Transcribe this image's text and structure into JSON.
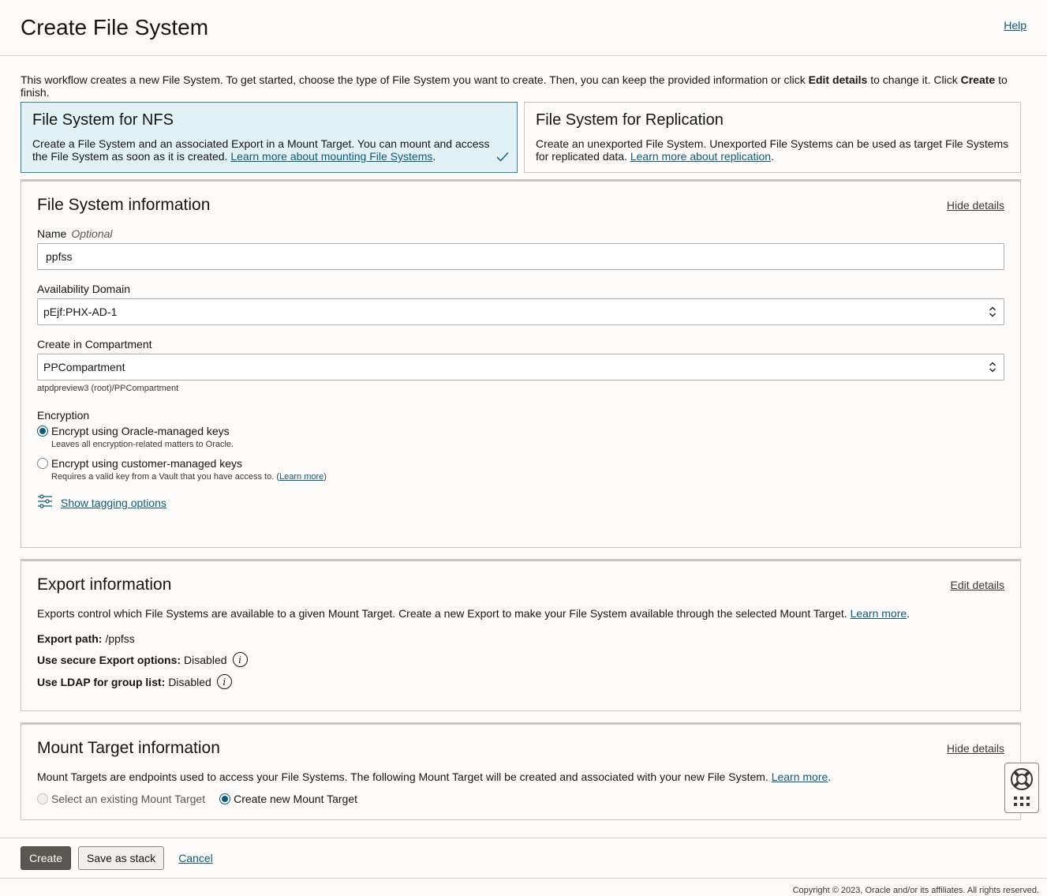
{
  "header": {
    "title": "Create File System",
    "help_label": "Help"
  },
  "intro": {
    "part1": "This workflow creates a new File System. To get started, choose the type of File System you want to create. Then, you can keep the provided information or click ",
    "bold1": "Edit details",
    "part2": " to change it. Click ",
    "bold2": "Create",
    "part3": " to finish."
  },
  "cards": [
    {
      "title": "File System for NFS",
      "desc": "Create a File System and an associated Export in a Mount Target. You can mount and access the File System as soon as it is created. ",
      "link": "Learn more about mounting File Systems",
      "suffix": ".",
      "selected": true
    },
    {
      "title": "File System for Replication",
      "desc": "Create an unexported File System. Unexported File Systems can be used as target File Systems for replicated data. ",
      "link": "Learn more about replication",
      "suffix": ".",
      "selected": false
    }
  ],
  "fs_info": {
    "title": "File System information",
    "toggle_label": "Hide details",
    "name_label": "Name",
    "name_optional": "Optional",
    "name_value": "ppfss",
    "ad_label": "Availability Domain",
    "ad_value": "pEjf:PHX-AD-1",
    "compartment_label": "Create in Compartment",
    "compartment_value": "PPCompartment",
    "compartment_path": "atpdpreview3 (root)/PPCompartment",
    "encryption_label": "Encryption",
    "enc_oracle_label": "Encrypt using Oracle-managed keys",
    "enc_oracle_help": "Leaves all encryption-related matters to Oracle.",
    "enc_customer_label": "Encrypt using customer-managed keys",
    "enc_customer_help": "Requires a valid key from a Vault that you have access to. (",
    "enc_customer_link": "Learn more",
    "enc_customer_help_end": ")",
    "tagging_label": "Show tagging options"
  },
  "export_info": {
    "title": "Export information",
    "toggle_label": "Edit details",
    "desc": "Exports control which File Systems are available to a given Mount Target. Create a new Export to make your File System available through the selected Mount Target. ",
    "desc_link": "Learn more",
    "desc_suffix": ".",
    "path_label": "Export path:",
    "path_value": "/ppfss",
    "secure_label": "Use secure Export options:",
    "secure_value": "Disabled",
    "ldap_label": "Use LDAP for group list:",
    "ldap_value": "Disabled"
  },
  "mount_info": {
    "title": "Mount Target information",
    "toggle_label": "Hide details",
    "desc": "Mount Targets are endpoints used to access your File Systems. The following Mount Target will be created and associated with your new File System. ",
    "desc_link": "Learn more",
    "desc_suffix": ".",
    "opt_existing": "Select an existing Mount Target",
    "opt_new": "Create new Mount Target"
  },
  "footer": {
    "create_label": "Create",
    "stack_label": "Save as stack",
    "cancel_label": "Cancel",
    "copyright": "Copyright © 2023, Oracle and/or its affiliates. All rights reserved."
  },
  "colors": {
    "accent": "#0e5a7a",
    "selected_card_bg": "#e2f1f5",
    "primary_button": "#5a5652"
  },
  "icons": [
    "checkmark-icon",
    "updown-chevron-icon",
    "tag-options-icon",
    "info-icon",
    "lifebuoy-icon",
    "grid-dots-icon"
  ]
}
